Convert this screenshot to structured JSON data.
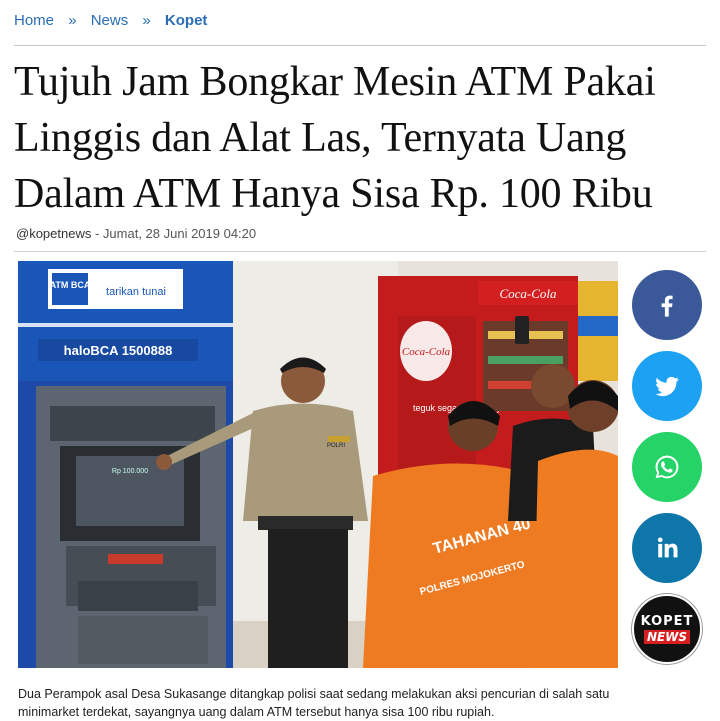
{
  "breadcrumb": {
    "home": "Home",
    "sep1": "»",
    "news": "News",
    "sep2": "»",
    "current": "Kopet"
  },
  "article": {
    "title": "Tujuh Jam Bongkar Mesin ATM Pakai Linggis dan Alat Las, Ternyata Uang Dalam ATM Hanya Sisa Rp. 100 Ribu",
    "author": "@kopetnews",
    "date": " - Jumat, 28 Juni 2019  04:20",
    "caption": "Dua Perampok asal Desa Sukasange ditangkap polisi saat sedang melakukan aksi pencurian di salah satu minimarket terdekat, sayangnya uang dalam ATM tersebut hanya sisa 100 ribu rupiah."
  },
  "photo": {
    "atm_brand": "ATM BCA",
    "atm_sign": "tarikan tunai",
    "atm_hotline": "haloBCA 1500888",
    "atm_screen": "Rp 100.000",
    "cocacola": "Coca-Cola",
    "fridge_text": "teguk segar sekarang",
    "shirt_text": "TAHANAN 40",
    "shirt_sub": "POLRES MOJOKERTO",
    "badge": "POLRI"
  },
  "share": {
    "facebook": "facebook-icon",
    "twitter": "twitter-icon",
    "whatsapp": "whatsapp-icon",
    "linkedin": "linkedin-icon",
    "brand_line1": "KOPET",
    "brand_line2": "NEWS"
  },
  "colors": {
    "link": "#2a6db5",
    "facebook": "#3b5998",
    "twitter": "#1da1f2",
    "whatsapp": "#25d366",
    "linkedin": "#0e76a8"
  }
}
